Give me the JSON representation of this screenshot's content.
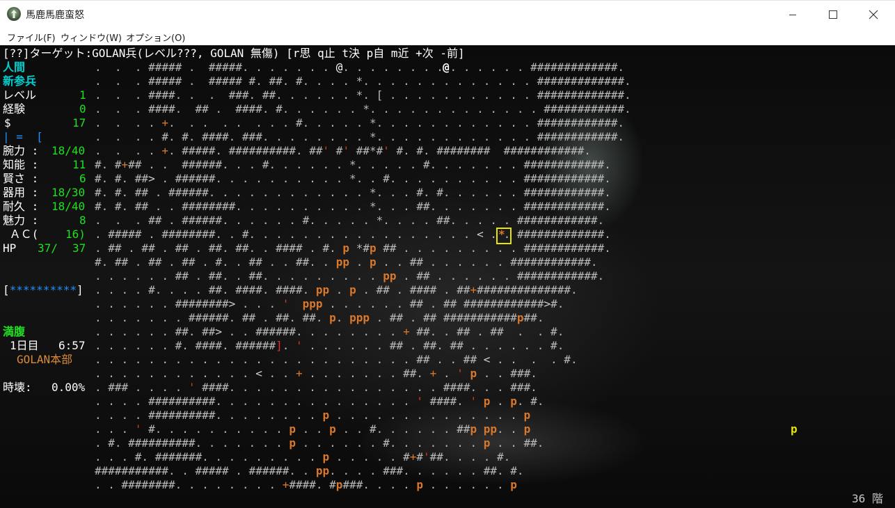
{
  "window": {
    "title": "馬鹿馬鹿蛮怒"
  },
  "menu": {
    "items": [
      "ファイル(F)",
      "ウィンドウ(W)",
      "オプション(O)"
    ]
  },
  "message": {
    "text": "[??]ターゲット:GOLAN兵(レベル???, GOLAN 無傷) [r思 q止 t決 p自 m近 +次 -前]"
  },
  "character": {
    "race": "人間",
    "title": "新参兵",
    "level_label": "レベル",
    "level": "1",
    "exp_label": "経験",
    "exp": "0",
    "gold_label": "$",
    "gold": "17",
    "equip_line": "| =  [",
    "stats": [
      {
        "label": "腕力 :",
        "value": "18/40"
      },
      {
        "label": "知能 :",
        "value": "11"
      },
      {
        "label": "賢さ :",
        "value": "6"
      },
      {
        "label": "器用 :",
        "value": "18/30"
      },
      {
        "label": "耐久 :",
        "value": "18/40"
      },
      {
        "label": "魅力 :",
        "value": "8"
      }
    ],
    "ac_label": " ＡＣ(",
    "ac_value": "16)",
    "hp_label": "HP",
    "hp_current": "37/",
    "hp_max": "37",
    "health_bar": "**********",
    "hunger": "満腹",
    "day_label": "1日目",
    "time": "6:57",
    "location": "GOLAN本部",
    "time_rip_label": "時壊:",
    "time_rip_value": "0.00%",
    "depth": "36 階"
  },
  "colors": {
    "race": "#00d0d0",
    "stat_value": "#20e020",
    "health_bar": "#1e90ff",
    "location": "#d98a3a",
    "monster": "#d9782a",
    "wall": "#b9b9b9",
    "player_target": "#e6e600",
    "hunger": "#20e020"
  },
  "map": {
    "rows": [
      ".  .  . ##### .  #####. . . . . . . @. . . . . . . . . . . . . . #############.",
      ".  .  . ##### .  ##### #. ##. #. . . . *. . . . . . . . . . . . . #############.",
      ".  .  . ####. .  .  ###. ##. . . . . . *. [ . . . . . . . . . . . #############.",
      ".  .  . ####.  ## .  ####. #. . . . . . *. . . . . . . . . . . . . ############.",
      ".  .  . . +.  . .  . .  . . . #. . . . . *. . . . . . . . . . . . ############.",
      ".  .  . . #. #. ####. ###. . . . . . . . *. . . . . . . . . . . . ############.",
      ".  .  . . +. #####. ##########. ##' #' ##*#' #. #. ########  ############.",
      "#. #+## . .  ######. . . #. . . . . . *. . . . . #. . . . . . . ############.",
      "#. #. ##> . ######. . . . . . . . . . *. . #. . . . . . . . . . ############.",
      "#. #. ## . ######. . . . . . . . . . . . *. . . #. #. . . . . . ############.",
      "#. #. ## . . ########. . . . . . . . . . *. . . ##. . . . . . . ############.",
      ".  .  . ## . ######. . . . . . #. . . . . *. . . . ##. . . . . ############.",
      ". ##### . ########. . #. . . . . . . . . . . . . . . . . < . . #############.",
      ". ## . ## . ## . ##. ##. . #### . #. p *#p ## . . . . . . . . . ############.",
      "#. ## . ## . ## . #. . ## . . ##. . pp . p . . ## . . . . . . ############.",
      ". . . . . . ## . ##. . ##. . . . . . . . . pp . ## . . . . . . ############.",
      ". . . . #. . . . ##. ####. ####. pp . p . ## . #### . ##+##############.",
      ". . . . . . ########> . . . '  ppp . . . . . . ## . ## ############>#.",
      ". . . . . . . ######. ## . ##. ##. p. ppp . ## . ## ###########p##.",
      ". . . . . . ##. ##> . . ######. . . . . . . . + ##. . ## . ##  .  . #.",
      ". . . . . . #. ####. ######]. ' . . . . . . ## . ##. ## . . . . . . #.",
      ". . . . . . . . . . . . . . . . . . . . . . . . ## . . ## < . .  .  . #.",
      ". . . . . . . . . . . . < . . + . . . . . . . ##. + . ' p . . ###.",
      ". ### . . . . ' ####. . . . . . . . . . . . . . . . ####. . . ###.",
      ". . . . ##########. . . . . . . . . . . . . . . ' ####. ' p . p. #.",
      ". . . . ##########. . . . . . . . p . . . . . . . . . . . . . . p",
      ". . . ' #. . . . . . . . . . p . . p . . #. . . . . . ##p pp. . p",
      ". #. ##########. . . . . . . p . . . . . . #. . . . . . . p . . ##.",
      ". . . #. #######. . . . . . . . . p . . . . . #+#'##. . . . #.",
      "###########. . ##### . ######. . pp. . . . ###. . . . . . ##. #.",
      ". . ########. . . . . . . . +####. #p###. . . . p . . . . . . p"
    ]
  }
}
